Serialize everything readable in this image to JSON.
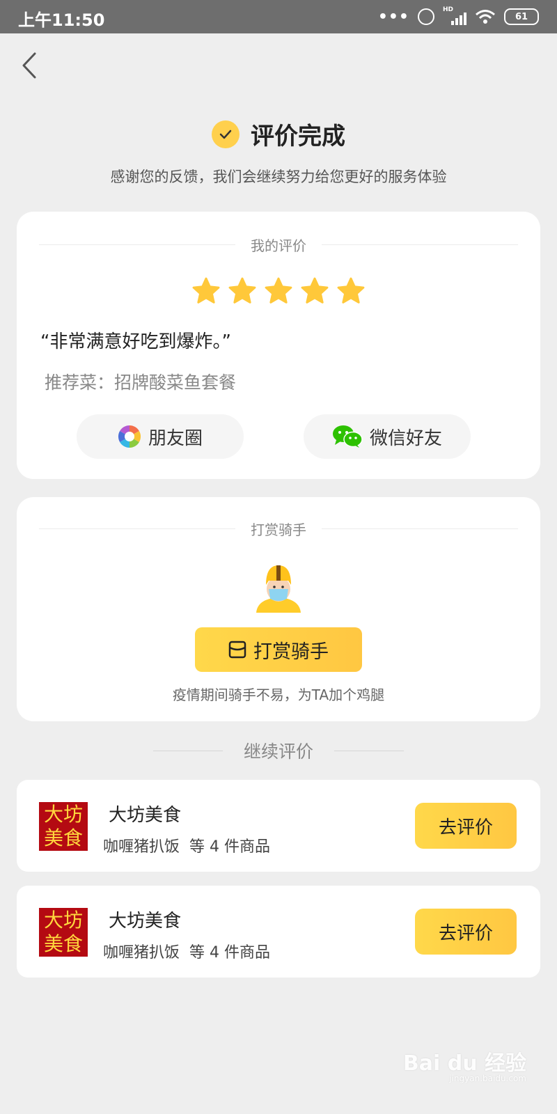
{
  "status_bar": {
    "time": "上午11:50",
    "dots": "•••",
    "network": "HD",
    "battery": "61"
  },
  "header": {
    "title": "评价完成",
    "subtitle": "感谢您的反馈，我们会继续努力给您更好的服务体验"
  },
  "my_review": {
    "section_title": "我的评价",
    "rating": 5,
    "max_rating": 5,
    "comment": "“非常满意好吃到爆炸。”",
    "recommended": "推荐菜：招牌酸菜鱼套餐",
    "share_moments": "朋友圈",
    "share_wechat": "微信好友"
  },
  "tip_rider": {
    "section_title": "打赏骑手",
    "button_label": "打赏骑手",
    "note": "疫情期间骑手不易，为TA加个鸡腿"
  },
  "continue_review": {
    "section_title": "继续评价",
    "orders": [
      {
        "shop_name": "大坊美食",
        "logo_line1": "大坊",
        "logo_line2": "美食",
        "items": "咖喱猪扒饭  等 4 件商品",
        "button": "去评价"
      },
      {
        "shop_name": "大坊美食",
        "logo_line1": "大坊",
        "logo_line2": "美食",
        "items": "咖喱猪扒饭  等 4 件商品",
        "button": "去评价"
      }
    ]
  },
  "watermark": {
    "brand": "Bai du 经验",
    "url": "jingyan.baidu.com"
  },
  "colors": {
    "accent": "#ffd04d",
    "star": "#ffc83a",
    "logo_bg": "#b40a12",
    "logo_text": "#ffd73d"
  }
}
